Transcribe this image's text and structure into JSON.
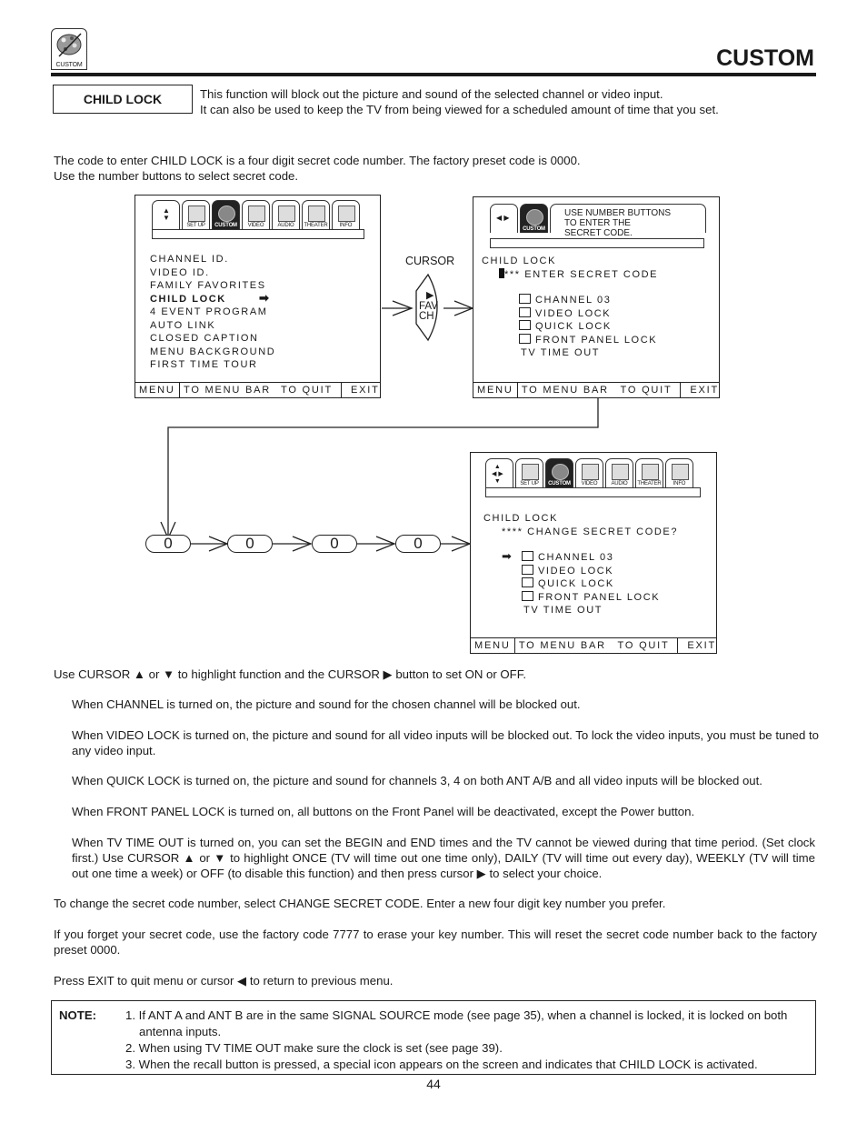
{
  "header": {
    "icon_label": "CUSTOM",
    "title": "CUSTOM"
  },
  "section": {
    "tag": "CHILD LOCK",
    "intro": [
      "This function will block out the picture and sound of the selected channel or video input.",
      "It can also be used to keep the TV from being viewed for a scheduled amount of time that you set."
    ],
    "code_info": [
      "The code to enter CHILD LOCK is a four digit secret code number.  The factory preset code is 0000.",
      "Use the number buttons to select secret code."
    ]
  },
  "tabs": [
    "SET UP",
    "CUSTOM",
    "VIDEO",
    "AUDIO",
    "THEATER",
    "INFO"
  ],
  "screen1": {
    "items": [
      "CHANNEL ID.",
      "VIDEO ID.",
      "FAMILY FAVORITES",
      "CHILD LOCK",
      "4 EVENT PROGRAM",
      "AUTO LINK",
      "CLOSED CAPTION",
      "MENU BACKGROUND",
      "FIRST TIME TOUR"
    ],
    "selected": "CHILD LOCK"
  },
  "cursor_button": {
    "caption": "CURSOR",
    "line1": "FAV",
    "line2": "CH"
  },
  "screen2": {
    "tab_label": "CUSTOM",
    "message": [
      "USE NUMBER BUTTONS",
      "TO ENTER THE",
      "SECRET CODE."
    ],
    "heading": "CHILD LOCK",
    "code_line": "*** ENTER SECRET CODE",
    "options": [
      "CHANNEL 03",
      "VIDEO LOCK",
      "QUICK LOCK",
      "FRONT PANEL LOCK"
    ],
    "time_out": "TV TIME OUT"
  },
  "digits": [
    "0",
    "0",
    "0",
    "0"
  ],
  "screen3": {
    "heading": "CHILD LOCK",
    "code_line": "**** CHANGE SECRET CODE?",
    "options": [
      "CHANNEL 03",
      "VIDEO LOCK",
      "QUICK LOCK",
      "FRONT PANEL LOCK"
    ],
    "time_out": "TV TIME OUT"
  },
  "footer": {
    "menu": "MENU",
    "to_menu_bar": "TO MENU BAR",
    "to_quit": "TO QUIT",
    "exit": "EXIT"
  },
  "instructions": {
    "cursor": "Use CURSOR ▲ or ▼ to highlight function and the CURSOR ▶ button to set ON or OFF.",
    "channel": "When CHANNEL is turned on, the picture and sound for the chosen channel will be blocked out.",
    "video_lock": "When VIDEO LOCK is turned on, the picture and sound for all video inputs will be blocked out. To lock the video inputs, you must be tuned to any video input.",
    "quick_lock": "When QUICK LOCK is turned on, the picture and sound for channels 3, 4 on both ANT A/B and all video inputs will be blocked out.",
    "front_panel": "When FRONT PANEL LOCK is turned on, all buttons on the Front Panel will be deactivated, except the Power button.",
    "time_out": "When TV TIME OUT is turned on, you can set the BEGIN and END times and the TV cannot be viewed during that time period. (Set clock first.) Use CURSOR ▲ or ▼ to highlight ONCE (TV will time out one time only), DAILY (TV will time out every day), WEEKLY (TV will time out one time a week) or OFF (to disable this function) and then press cursor ▶ to select your choice.",
    "change_code": "To change the secret code number, select CHANGE SECRET CODE.  Enter a new four digit key number you prefer.",
    "forget_code": "If you forget your secret code, use the factory code 7777 to erase your key number. This will reset the secret code number back to the factory preset 0000.",
    "exit": "Press EXIT to quit menu or cursor ◀  to return to previous menu."
  },
  "note": {
    "label": "NOTE:",
    "items": [
      "1. If ANT A and ANT B are in the same SIGNAL SOURCE mode (see page 35), when a channel is locked, it is locked on both antenna inputs.",
      "2. When using TV TIME OUT make sure the clock is set (see page 39).",
      "3. When the recall button is pressed, a special icon appears on the screen and indicates that CHILD LOCK is activated."
    ]
  },
  "page_number": "44"
}
